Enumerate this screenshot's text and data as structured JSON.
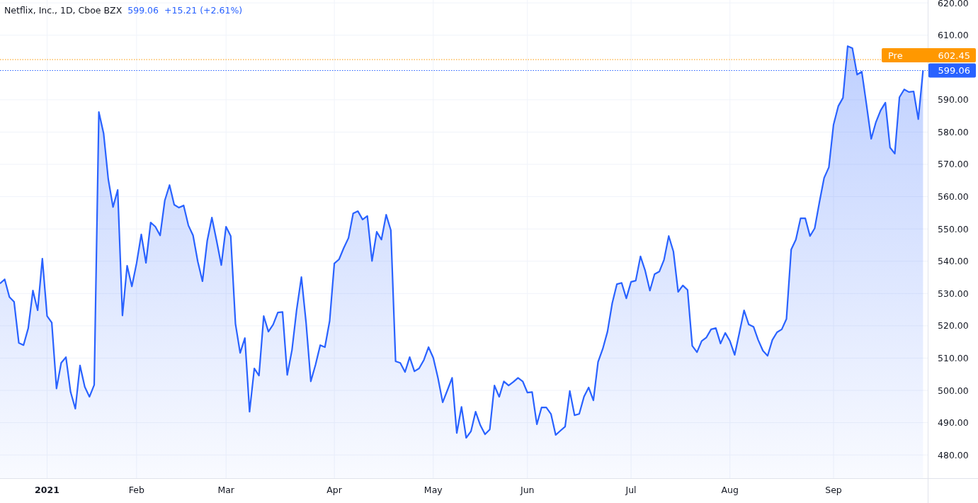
{
  "legend": {
    "symbol": "Netflix, Inc., 1D, Cboe BZX",
    "price": "599.06",
    "change": "+15.21 (+2.61%)"
  },
  "price_tags": [
    {
      "label": "Pre"
    }
  ],
  "chart": {
    "chart_data": {
      "type": "area",
      "grid": true,
      "ylim": [
        472.8,
        620.9
      ],
      "categories": [
        null,
        null,
        null,
        null,
        null,
        null,
        null,
        null,
        null,
        null,
        "2021",
        null,
        null,
        null,
        null,
        null,
        null,
        null,
        null,
        null,
        null,
        null,
        null,
        null,
        null,
        null,
        null,
        null,
        null,
        "Feb",
        null,
        null,
        null,
        null,
        null,
        null,
        null,
        null,
        null,
        null,
        null,
        null,
        null,
        null,
        null,
        null,
        null,
        null,
        "Mar",
        null,
        null,
        null,
        null,
        null,
        null,
        null,
        null,
        null,
        null,
        null,
        null,
        null,
        null,
        null,
        null,
        null,
        null,
        null,
        null,
        null,
        null,
        "Apr",
        null,
        null,
        null,
        null,
        null,
        null,
        null,
        null,
        null,
        null,
        null,
        null,
        null,
        null,
        null,
        null,
        null,
        null,
        null,
        null,
        "May",
        null,
        null,
        null,
        null,
        null,
        null,
        null,
        null,
        null,
        null,
        null,
        null,
        null,
        null,
        null,
        null,
        null,
        null,
        null,
        "Jun",
        null,
        null,
        null,
        null,
        null,
        null,
        null,
        null,
        null,
        null,
        null,
        null,
        null,
        null,
        null,
        null,
        null,
        null,
        null,
        null,
        null,
        "Jul",
        null,
        null,
        null,
        null,
        null,
        null,
        null,
        null,
        null,
        null,
        null,
        null,
        null,
        null,
        null,
        null,
        null,
        null,
        null,
        null,
        "Aug",
        null,
        null,
        null,
        null,
        null,
        null,
        null,
        null,
        null,
        null,
        null,
        null,
        null,
        null,
        null,
        null,
        null,
        null,
        null,
        null,
        null,
        "Sep",
        null,
        null,
        null,
        null,
        null,
        null,
        null,
        null,
        null,
        null,
        null,
        null,
        null,
        null,
        null,
        null,
        null,
        null,
        null
      ],
      "yticks": [
        {
          "value": 480,
          "label": "480.00"
        },
        {
          "value": 490,
          "label": "490.00"
        },
        {
          "value": 500,
          "label": "500.00"
        },
        {
          "value": 510,
          "label": "510.00"
        },
        {
          "value": 520,
          "label": "520.00"
        },
        {
          "value": 530,
          "label": "530.00"
        },
        {
          "value": 540,
          "label": "540.00"
        },
        {
          "value": 550,
          "label": "550.00"
        },
        {
          "value": 560,
          "label": "560.00"
        },
        {
          "value": 570,
          "label": "570.00"
        },
        {
          "value": 580,
          "label": "580.00"
        },
        {
          "value": 590,
          "label": "590.00"
        },
        {
          "value": 610,
          "label": "610.00"
        },
        {
          "value": 620,
          "label": "620.00"
        }
      ],
      "ref_lines": [
        {
          "axis": "y",
          "value": 602.45,
          "label": "602.45",
          "color": "#ff9800"
        },
        {
          "axis": "y",
          "value": 599.06,
          "label": "599.06",
          "color": "#2962ff"
        }
      ],
      "series": [
        {
          "color": "#2962ff",
          "values": [
            533.1,
            534.4,
            528.9,
            527.4,
            514.7,
            514.0,
            519.3,
            530.9,
            524.8,
            540.8,
            523.0,
            521.0,
            500.6,
            508.5,
            510.3,
            499.5,
            494.3,
            507.7,
            501.1,
            498.0,
            501.7,
            586.2,
            579.6,
            565.4,
            556.8,
            562.1,
            523.2,
            538.6,
            532.2,
            539.3,
            548.3,
            539.5,
            552.0,
            550.7,
            548.0,
            558.8,
            563.6,
            557.5,
            556.6,
            557.3,
            551.1,
            548.0,
            539.9,
            533.8,
            546.3,
            553.5,
            546.3,
            538.8,
            550.7,
            547.8,
            520.6,
            511.6,
            516.2,
            493.4,
            506.8,
            504.6,
            523.0,
            518.2,
            520.4,
            524.1,
            524.3,
            504.8,
            512.5,
            525.0,
            535.1,
            521.0,
            502.8,
            507.9,
            514.0,
            513.4,
            521.5,
            539.3,
            540.6,
            544.1,
            547.2,
            554.8,
            555.5,
            552.9,
            554.0,
            540.1,
            549.1,
            546.7,
            554.4,
            549.6,
            509.0,
            508.5,
            505.7,
            510.3,
            505.9,
            506.8,
            509.4,
            513.4,
            510.1,
            503.9,
            496.3,
            500.0,
            503.9,
            486.8,
            494.9,
            485.3,
            487.3,
            493.4,
            489.2,
            486.4,
            487.9,
            501.5,
            498.0,
            502.8,
            501.5,
            502.6,
            503.9,
            502.8,
            499.3,
            499.5,
            489.5,
            494.7,
            494.7,
            492.7,
            486.2,
            487.5,
            488.8,
            499.8,
            492.3,
            492.7,
            498.0,
            500.9,
            496.9,
            508.8,
            512.9,
            518.2,
            527.0,
            532.9,
            533.3,
            528.5,
            533.6,
            534.0,
            541.5,
            537.1,
            530.9,
            536.0,
            536.8,
            540.4,
            547.8,
            543.0,
            530.5,
            532.5,
            531.1,
            513.8,
            511.8,
            515.3,
            516.4,
            518.9,
            519.3,
            514.5,
            517.8,
            515.3,
            511.0,
            517.8,
            524.8,
            520.4,
            519.7,
            515.6,
            512.3,
            510.7,
            515.6,
            518.0,
            518.9,
            522.1,
            543.6,
            546.7,
            553.3,
            553.3,
            547.8,
            550.2,
            558.3,
            565.8,
            569.1,
            582.3,
            588.0,
            590.6,
            606.6,
            606.0,
            597.8,
            598.7,
            588.4,
            577.9,
            583.1,
            586.7,
            589.1,
            575.2,
            573.3,
            590.8,
            593.2,
            592.4,
            592.6,
            584.0,
            599.1
          ]
        }
      ]
    }
  }
}
